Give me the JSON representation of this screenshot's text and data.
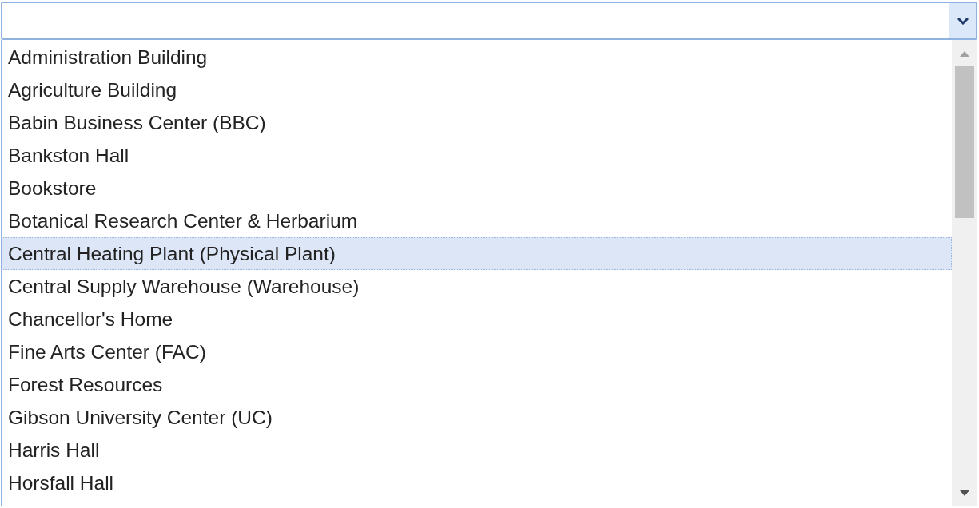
{
  "combo": {
    "expanded": true
  },
  "options": [
    {
      "label": "Administration Building",
      "selected": false
    },
    {
      "label": "Agriculture Building",
      "selected": false
    },
    {
      "label": "Babin Business Center (BBC)",
      "selected": false
    },
    {
      "label": "Bankston Hall",
      "selected": false
    },
    {
      "label": "Bookstore",
      "selected": false
    },
    {
      "label": "Botanical Research Center & Herbarium",
      "selected": false
    },
    {
      "label": "Central Heating Plant (Physical Plant)",
      "selected": true
    },
    {
      "label": "Central Supply Warehouse (Warehouse)",
      "selected": false
    },
    {
      "label": "Chancellor's Home",
      "selected": false
    },
    {
      "label": "Fine Arts Center (FAC)",
      "selected": false
    },
    {
      "label": "Forest Resources",
      "selected": false
    },
    {
      "label": "Gibson University Center (UC)",
      "selected": false
    },
    {
      "label": "Harris Hall",
      "selected": false
    },
    {
      "label": "Horsfall Hall",
      "selected": false
    }
  ]
}
